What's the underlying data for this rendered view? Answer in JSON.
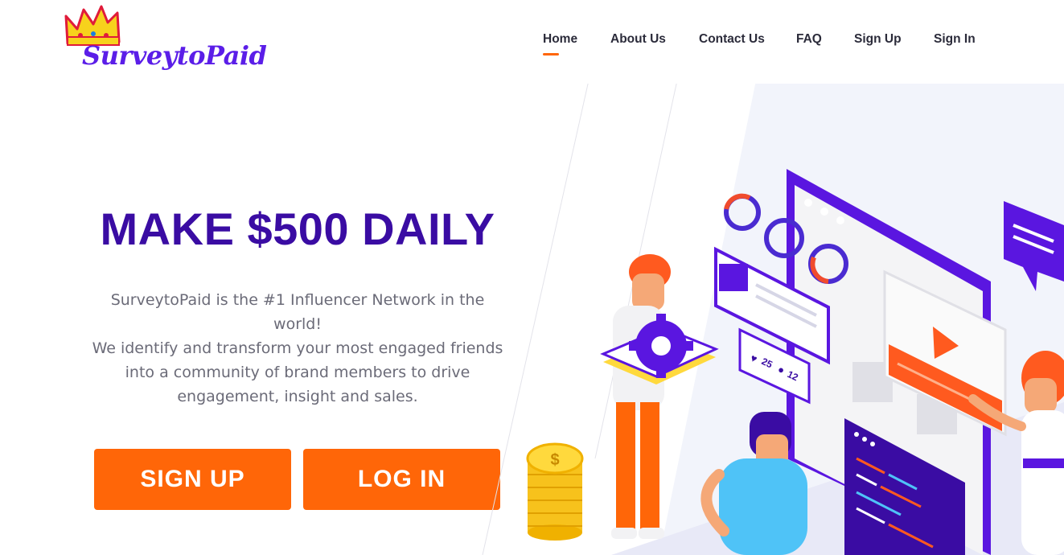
{
  "brand": {
    "name": "SurveytoPaid",
    "colors": {
      "primary": "#3a0ca3",
      "accent": "#ff6608",
      "logo_text": "#5b1ee8"
    }
  },
  "nav": {
    "items": [
      {
        "label": "Home",
        "active": true
      },
      {
        "label": "About Us"
      },
      {
        "label": "Contact Us"
      },
      {
        "label": "FAQ"
      },
      {
        "label": "Sign Up"
      },
      {
        "label": "Sign In"
      }
    ]
  },
  "hero": {
    "title": "MAKE $500 DAILY",
    "description_lines": [
      "SurveytoPaid is the #1 Influencer Network in the",
      "world!",
      "We identify and transform your most engaged friends",
      "into a community of brand members to drive",
      "engagement, insight and sales."
    ],
    "buttons": {
      "signup": "SIGN UP",
      "login": "LOG IN"
    }
  },
  "illustration": {
    "likes": "25",
    "comments": "12",
    "coin_symbol": "$"
  }
}
